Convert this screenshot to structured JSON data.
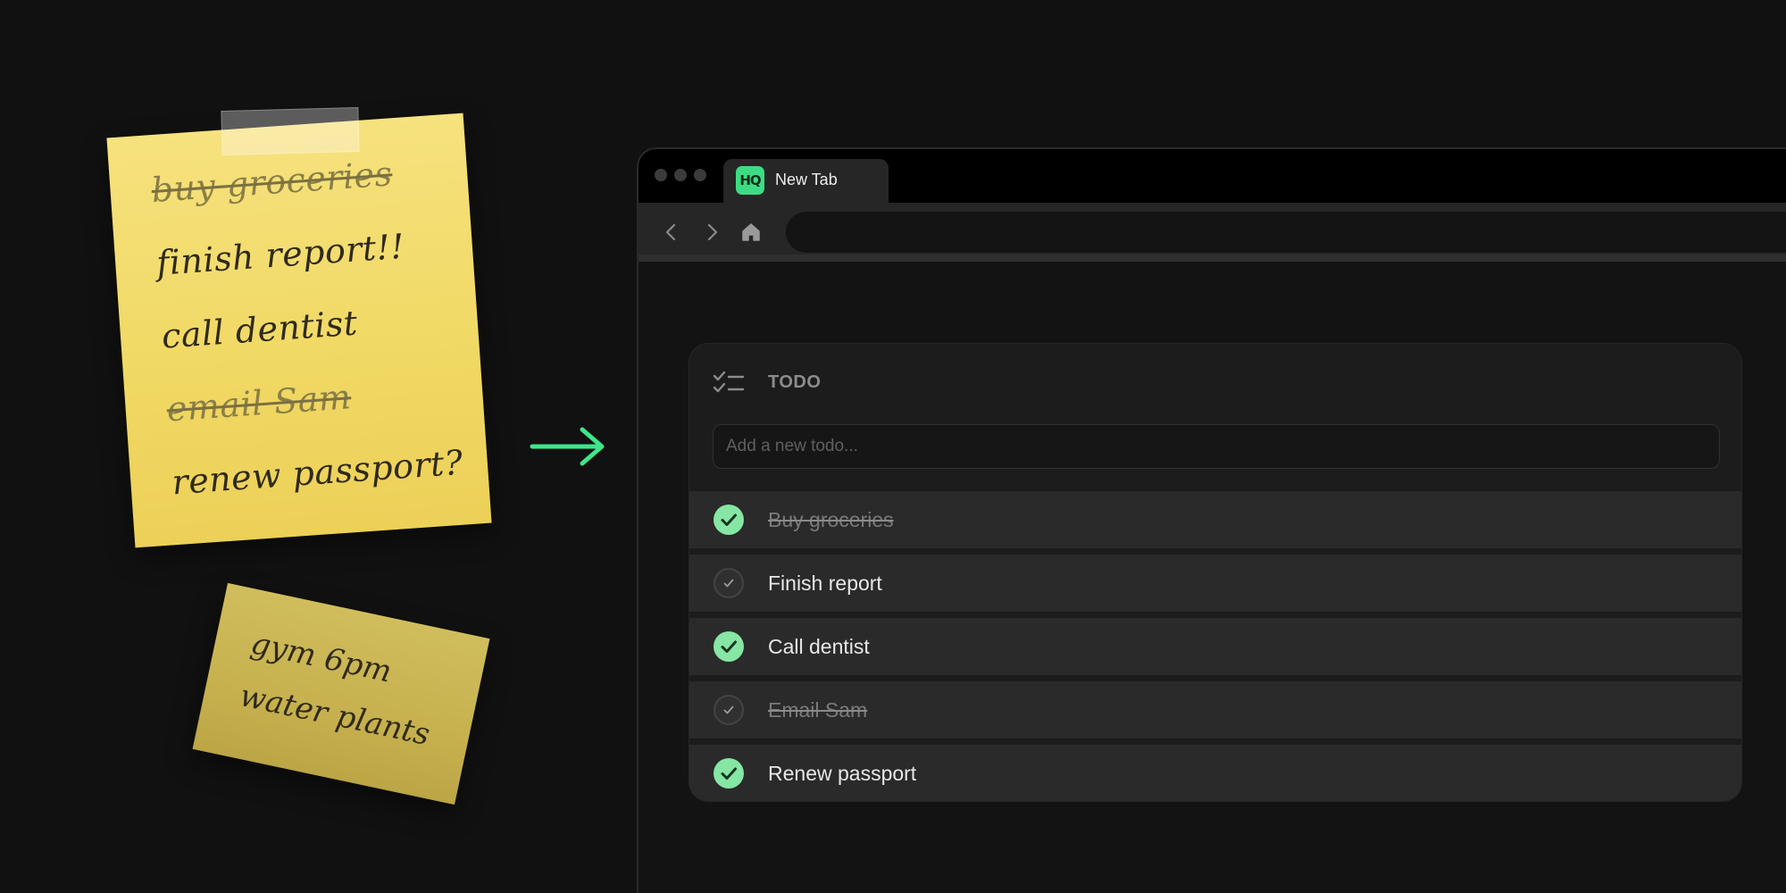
{
  "sticky_note_main": {
    "lines": [
      {
        "text": "buy groceries",
        "crossed_out": true
      },
      {
        "text": "finish report!!",
        "crossed_out": false
      },
      {
        "text": "call dentist",
        "crossed_out": false
      },
      {
        "text": "email Sam",
        "crossed_out": true
      },
      {
        "text": "renew passport?",
        "crossed_out": false
      }
    ]
  },
  "sticky_note_small": {
    "lines": [
      "gym 6pm",
      "water plants"
    ]
  },
  "browser": {
    "tab": {
      "logo_text": "HQ",
      "title": "New Tab"
    },
    "toolbar": {
      "icons": [
        "back-arrow-icon",
        "forward-arrow-icon",
        "home-icon"
      ]
    }
  },
  "todo": {
    "title": "TODO",
    "icon": "checklist-icon",
    "input": {
      "placeholder": "Add a new todo...",
      "value": ""
    },
    "items": [
      {
        "text": "Buy groceries",
        "checked": true,
        "struck": true
      },
      {
        "text": "Finish report",
        "checked": false,
        "struck": false
      },
      {
        "text": "Call dentist",
        "checked": true,
        "struck": false
      },
      {
        "text": "Email Sam",
        "checked": false,
        "struck": true
      },
      {
        "text": "Renew passport",
        "checked": true,
        "struck": false
      }
    ]
  },
  "colors": {
    "accent_green": "#3ddc84",
    "check_green": "#86e6a4",
    "arrow_green": "#3ee68a",
    "note_yellow": "#f1d965",
    "note_yellow_dark": "#c7b14f",
    "background": "#111111"
  }
}
